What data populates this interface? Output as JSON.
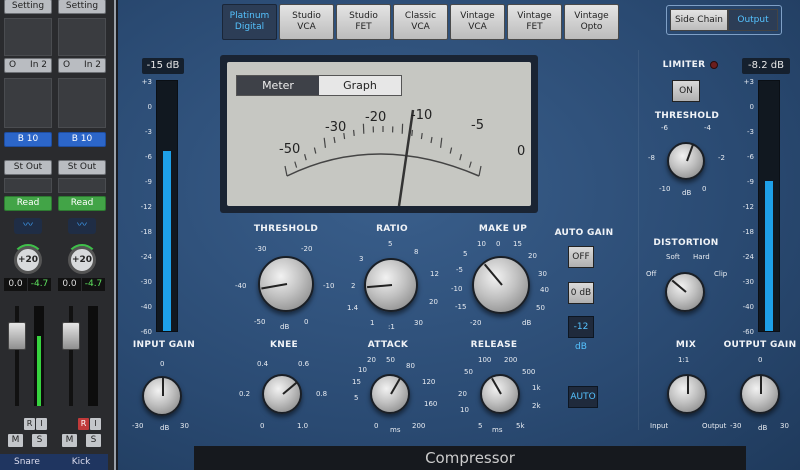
{
  "mixer": {
    "strips": [
      {
        "setting": "Setting",
        "input": "In 2",
        "bus": "B 10",
        "output": "St Out",
        "automation": "Read",
        "pan": "+20",
        "volume": "0.0",
        "peak": "-4.7",
        "r": "R",
        "i": "I",
        "m": "M",
        "s": "S",
        "name": "Snare",
        "ring": "O"
      },
      {
        "setting": "Setting",
        "input": "In 2",
        "bus": "B 10",
        "output": "St Out",
        "automation": "Read",
        "pan": "+20",
        "volume": "0.0",
        "peak": "-4.7",
        "r": "R",
        "i": "I",
        "m": "M",
        "s": "S",
        "name": "Kick",
        "ring": "O"
      }
    ]
  },
  "plugin": {
    "title": "Compressor",
    "models": [
      "Platinum\nDigital",
      "Studio\nVCA",
      "Studio\nFET",
      "Classic\nVCA",
      "Vintage\nVCA",
      "Vintage\nFET",
      "Vintage\nOpto"
    ],
    "active_model": 0,
    "sidechain": "Side Chain",
    "output_btn": "Output",
    "input_db": "-15 dB",
    "output_db": "-8.2 dB",
    "input_meter_level": 0.72,
    "output_meter_level": 0.6,
    "meter_scale": [
      "+3",
      "0",
      "-3",
      "-6",
      "-9",
      "-12",
      "-18",
      "-24",
      "-30",
      "-40",
      "-60"
    ],
    "view_tabs": [
      "Meter",
      "Graph"
    ],
    "vu_scale": [
      "-50",
      "-30",
      "-20",
      "-10",
      "-5",
      "0"
    ],
    "threshold": {
      "label": "THRESHOLD",
      "ticks": [
        "-30",
        "-20",
        "-40",
        "-10",
        "-50",
        "0"
      ],
      "unit": "dB"
    },
    "ratio": {
      "label": "RATIO",
      "ticks": [
        "5",
        "3",
        "8",
        "12",
        "2",
        "20",
        "1.4",
        "30",
        "1",
        ":1"
      ]
    },
    "makeup": {
      "label": "MAKE UP",
      "ticks": [
        "5",
        "10",
        "0",
        "15",
        "-5",
        "20",
        "-10",
        "30",
        "-15",
        "40",
        "-20",
        "50",
        "dB"
      ]
    },
    "autogain": {
      "label": "AUTO GAIN",
      "off": "OFF",
      "zero": "0 dB",
      "minus12": "-12 dB"
    },
    "knee": {
      "label": "KNEE",
      "ticks": [
        "0.4",
        "0.6",
        "0.2",
        "0.8",
        "0",
        "1.0"
      ]
    },
    "attack": {
      "label": "ATTACK",
      "ticks": [
        "20",
        "50",
        "10",
        "80",
        "15",
        "120",
        "5",
        "160",
        "0",
        "200",
        "ms"
      ]
    },
    "release": {
      "label": "RELEASE",
      "ticks": [
        "100",
        "200",
        "50",
        "500",
        "20",
        "1k",
        "10",
        "2k",
        "5",
        "5k",
        "ms"
      ]
    },
    "auto_btn": "AUTO",
    "input_gain": {
      "label": "INPUT GAIN",
      "ticks": [
        "0",
        "-30",
        "dB",
        "30"
      ]
    },
    "limiter": {
      "label": "LIMITER",
      "on": "ON",
      "threshold": "THRESHOLD",
      "ticks": [
        "-6",
        "-4",
        "-8",
        "-2",
        "-10",
        "0",
        "dB"
      ]
    },
    "distortion": {
      "label": "DISTORTION",
      "ticks": [
        "Soft",
        "Hard",
        "Off",
        "Clip"
      ]
    },
    "mix": {
      "label": "MIX",
      "ticks": [
        "1:1",
        "Input",
        "Output"
      ]
    },
    "output_gain": {
      "label": "OUTPUT GAIN",
      "ticks": [
        "0",
        "-30",
        "dB",
        "30"
      ]
    }
  }
}
